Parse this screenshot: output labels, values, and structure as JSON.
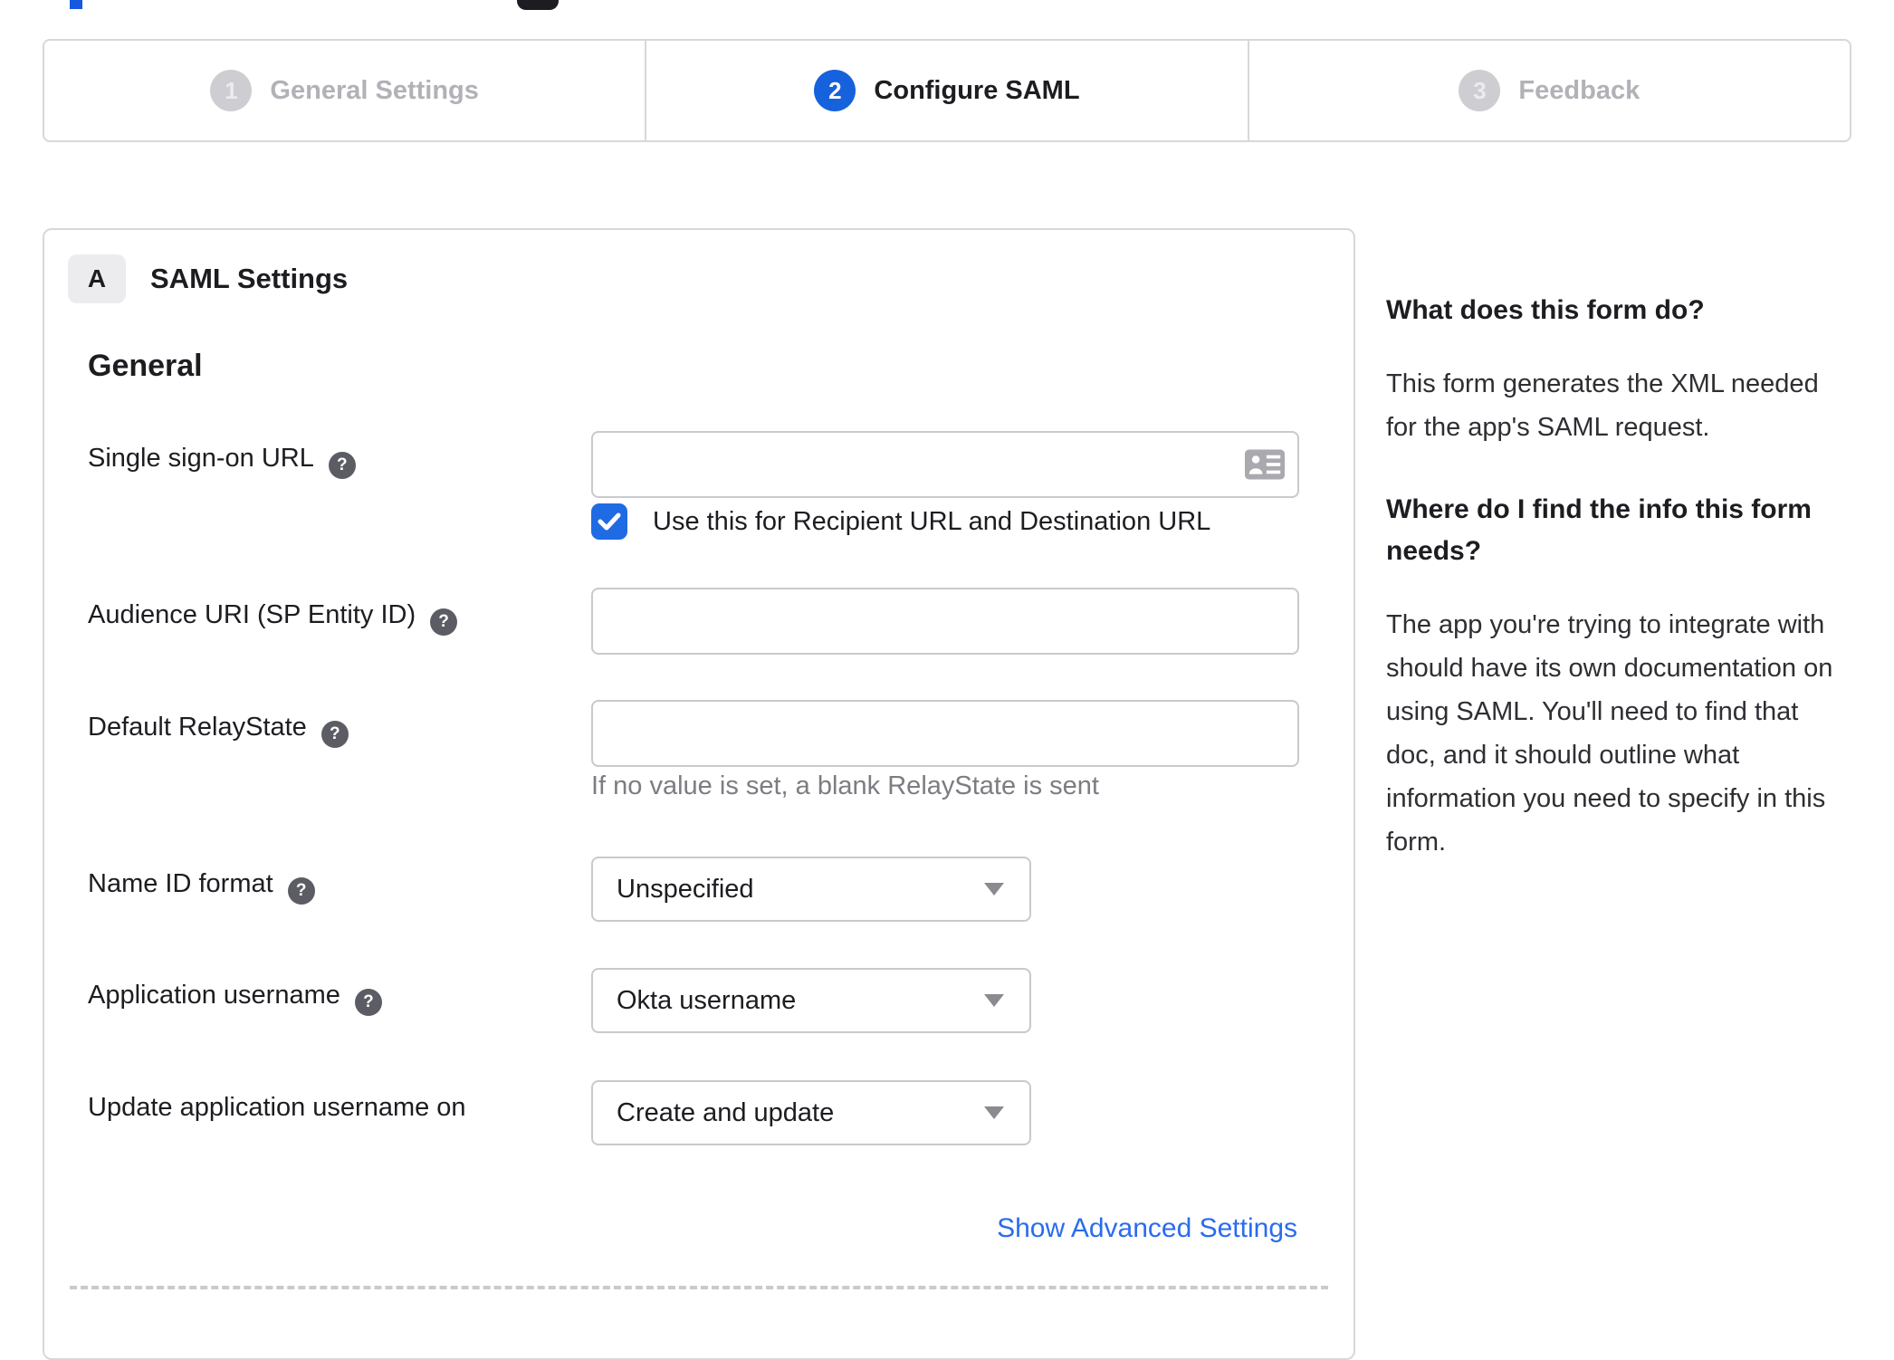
{
  "colors": {
    "primary_blue": "#1662dd",
    "checkbox_blue": "#1f6be4",
    "link_blue": "#2a6ced",
    "inactive_gray": "#cdcdd2",
    "border_gray": "#c9c9ce",
    "panel_border": "#d7d7dc",
    "helper_gray": "#7c7c82"
  },
  "icons": {
    "help_glyph": "?"
  },
  "stepper": {
    "steps": [
      {
        "number": "1",
        "label": "General Settings",
        "state": "inactive"
      },
      {
        "number": "2",
        "label": "Configure SAML",
        "state": "active"
      },
      {
        "number": "3",
        "label": "Feedback",
        "state": "inactive"
      }
    ]
  },
  "panel": {
    "section_badge": "A",
    "section_title": "SAML Settings",
    "group_heading": "General",
    "fields": [
      {
        "label": "Single sign-on URL",
        "type": "text",
        "value": "",
        "trailing_icon": "contact-card",
        "checkbox": {
          "checked": true,
          "label": "Use this for Recipient URL and Destination URL"
        }
      },
      {
        "label": "Audience URI (SP Entity ID)",
        "type": "text",
        "value": ""
      },
      {
        "label": "Default RelayState",
        "type": "text",
        "value": "",
        "helper": "If no value is set, a blank RelayState is sent"
      },
      {
        "label": "Name ID format",
        "type": "select",
        "value": "Unspecified"
      },
      {
        "label": "Application username",
        "type": "select",
        "value": "Okta username"
      },
      {
        "label": "Update application username on",
        "type": "select",
        "value": "Create and update"
      }
    ],
    "advanced_link": "Show Advanced Settings"
  },
  "help_panel": {
    "q1_title": "What does this form do?",
    "q1_body": "This form generates the XML needed for the app's SAML request.",
    "q2_title": "Where do I find the info this form needs?",
    "q2_body": "The app you're trying to integrate with should have its own documentation on using SAML. You'll need to find that doc, and it should outline what information you need to specify in this form."
  }
}
